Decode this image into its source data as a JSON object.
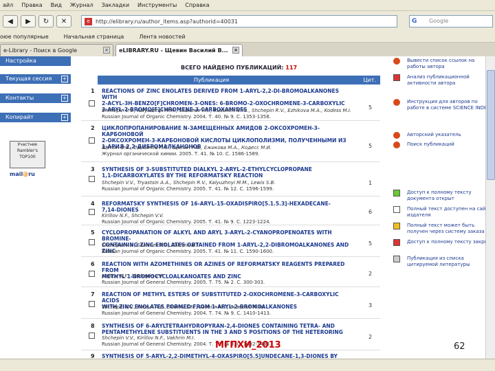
{
  "menu": [
    "айл",
    "Правка",
    "Вид",
    "Журнал",
    "Закладки",
    "Инструменты",
    "Справка"
  ],
  "address": {
    "url": "http://elibrary.ru/author_items.asp?authorid=40031",
    "favicon": "e"
  },
  "search": {
    "placeholder": "Google",
    "engine": "G"
  },
  "bookmarks": [
    "оюе популярные",
    "Начальная страница",
    "Лента новостей"
  ],
  "tabs": [
    {
      "label": "e-Library - Поиск в Google",
      "active": false
    },
    {
      "label": "eLIBRARY.RU - Щевин Василий В...",
      "active": true
    }
  ],
  "sidebar": {
    "items": [
      "Настройка",
      "Текущая сессия",
      "Контакты",
      "Копирайт"
    ],
    "counter": {
      "line1": "Участник",
      "line2": "Rambler's",
      "line3": "TOP100"
    },
    "mailru": {
      "a": "mail",
      "b": "ru"
    }
  },
  "main": {
    "total_label": "ВСЕГО НАЙДЕНО ПУБЛИКАЦИЙ:",
    "total_count": "117",
    "col_pub": "Публикация",
    "col_cit": "Цит.",
    "rows": [
      {
        "num": "1",
        "title": "REACTIONS OF ZINC ENOLATES DERIVED FROM 1-ARYL-2,2-DI-BROMOALKANONES WITH\n2-ACYL-3H-BENZO[F]CHROMEN-3-ONES: 6-BROMO-2-OXOCHROMENE-3-CARBOXYLIC\n3-ARYL-2-BROMO[F]CHROMENE-3-CARBOXAMIDES",
        "authors": "Shchepin V.V., Kalyuzhnyi M.M., Silaichev P.S., Russkikh N.Yu., Shchepin R.V., Ezhikova M.A., Kodess M.I.",
        "journal": "Russian Journal of Organic Chemistry. 2004. Т. 40. № 9. С. 1353-1358.",
        "cit": "5"
      },
      {
        "num": "2",
        "title": "ЦИКЛОПРОПАНИРОВАНИЕ N-ЗАМЕЩЕННЫХ АМИДОВ 2-ОКСОХРОМЕН-3-КАРБОНОВОЙ\n2-ОКСОХРОМЕН-3-КАРБОНОВОЙ КИСЛОТЫ ЦИКЛОПОЛИЗМИ, ПОЛУЧЕННЫМИ ИЗ\n1-АРИЛ-2,2-ДИБРОМАЛКАНОНОВ",
        "authors": "Щепин В.В., Силайчев П.С., Щепин Р.В., Ежикова М.А., Кодесс М.И.",
        "journal": "Журнал органической химии. 2005. Т. 41. № 10. С. 1586-1589.",
        "cit": "5"
      },
      {
        "num": "3",
        "title": "SYNTHESIS OF 3-SUBSTITUTED DIALKYL 2-ARYL-2-ETHYLCYCLOPROPANE\n1,1-DICARBOXYLATES BY THE REFORMATSKY REACTION",
        "authors": "Shchepin V.V., Tryastsin A.A., Shchepin R.V., Kalyuzhnyi M.M., Lewis S.B.",
        "journal": "Russian Journal of Organic Chemistry. 2005. Т. 41. № 12. С. 1596-1599.",
        "cit": "1"
      },
      {
        "num": "4",
        "title": "REFORMATSKY SYNTHESIS OF 16-ARYL-15-OXADISPIRO[5.1.5.3]-HEXADECANE-\n7,14-DIONES",
        "authors": "Kirillov N.F., Shchepin V.V.",
        "journal": "Russian Journal of Organic Chemistry. 2005. Т. 41. № 9. С. 1223-1224.",
        "cit": "6"
      },
      {
        "num": "5",
        "title": "CYCLOPROPANATION OF ALKYL AND ARYL 3-ARYL-2-CYANOPROPENOATES WITH BROMINE-\nCONTAINING ZINC ENOLATES OBTAINED FROM 1-ARYL-2,2-DIBROMOALKANONES AND ZINC",
        "authors": "Shchepin V.V., Silaichev P.S., Vakhrin M.I.",
        "journal": "Russian Journal of Organic Chemistry. 2005. Т. 41. № 11. С. 1590-1600.",
        "cit": "5"
      },
      {
        "num": "6",
        "title": "REACTION WITH AZOMETHINES OR AZINES OF REFORMATSKY REAGENTS PREPARED FROM\nMETHYL 1-BROMOCYCLOALKANOATES AND ZINC",
        "authors": "Kirillov N.F., Shchepin V.V.",
        "journal": "Russian Journal of General Chemistry. 2005. Т. 75. № 2. С. 300-303.",
        "cit": "2"
      },
      {
        "num": "7",
        "title": "REACTION OF METHYL ESTERS OF SUBSTITUTED 2-OXOCHROMENE-3-CARBOXYLIC ACIDS\nWITH ZINC ENOLATES FORMED FROM 1-ARYL-2-BROMOALKANONES",
        "authors": "Shchepin V.V., Korzun A.E., Shurov S.N., Vakhrin M.I., Russkikh N.Yu.",
        "journal": "Russian Journal of General Chemistry. 2004. Т. 74. № 9. С. 1410-1413.",
        "cit": "3"
      },
      {
        "num": "8",
        "title": "SYNTHESIS OF 6-ARYLTETRAHYDROPYRAN-2,4-DIONES CONTAINING TETRA- AND\nPENTAMETHYLENE SUBSTITUENTS IN THE 3 AND 5 POSITIONS OF THE HETERORING",
        "authors": "Shchepin V.V., Kirillov N.F., Vakhrin M.I.",
        "journal": "Russian Journal of General Chemistry. 2004. Т. 74. № 9. С. 1432-1433.",
        "cit": "2"
      },
      {
        "num": "9",
        "title": "SYNTHESIS OF 5-ARYL-2,2-DIMETHYL-4-OXASPIRO[5.5]UNDECANE-1,3-DIONES BY",
        "authors": "",
        "journal": "",
        "cit": ""
      }
    ]
  },
  "right": {
    "items": [
      "Вывести список ссылок на работы автора",
      "Анализ публикационной активности автора",
      "Инструкция для авторов по работе в системе SCIENCE INDEX",
      "Авторский указатель",
      "Поиск публикаций",
      "Доступ к полному тексту документа открыт",
      "Полный текст доступен на сайте издателя",
      "Полный текст может быть получен через систему заказа",
      "Доступ к полному тексту закрыт",
      "Публикация из списка цитируемой литературы"
    ]
  },
  "footer": {
    "mark": "МГПХИ_2013",
    "page": "62"
  },
  "colors": {
    "accent": "#3d6fb6",
    "title": "#1c3a8f",
    "count": "#c00000"
  }
}
